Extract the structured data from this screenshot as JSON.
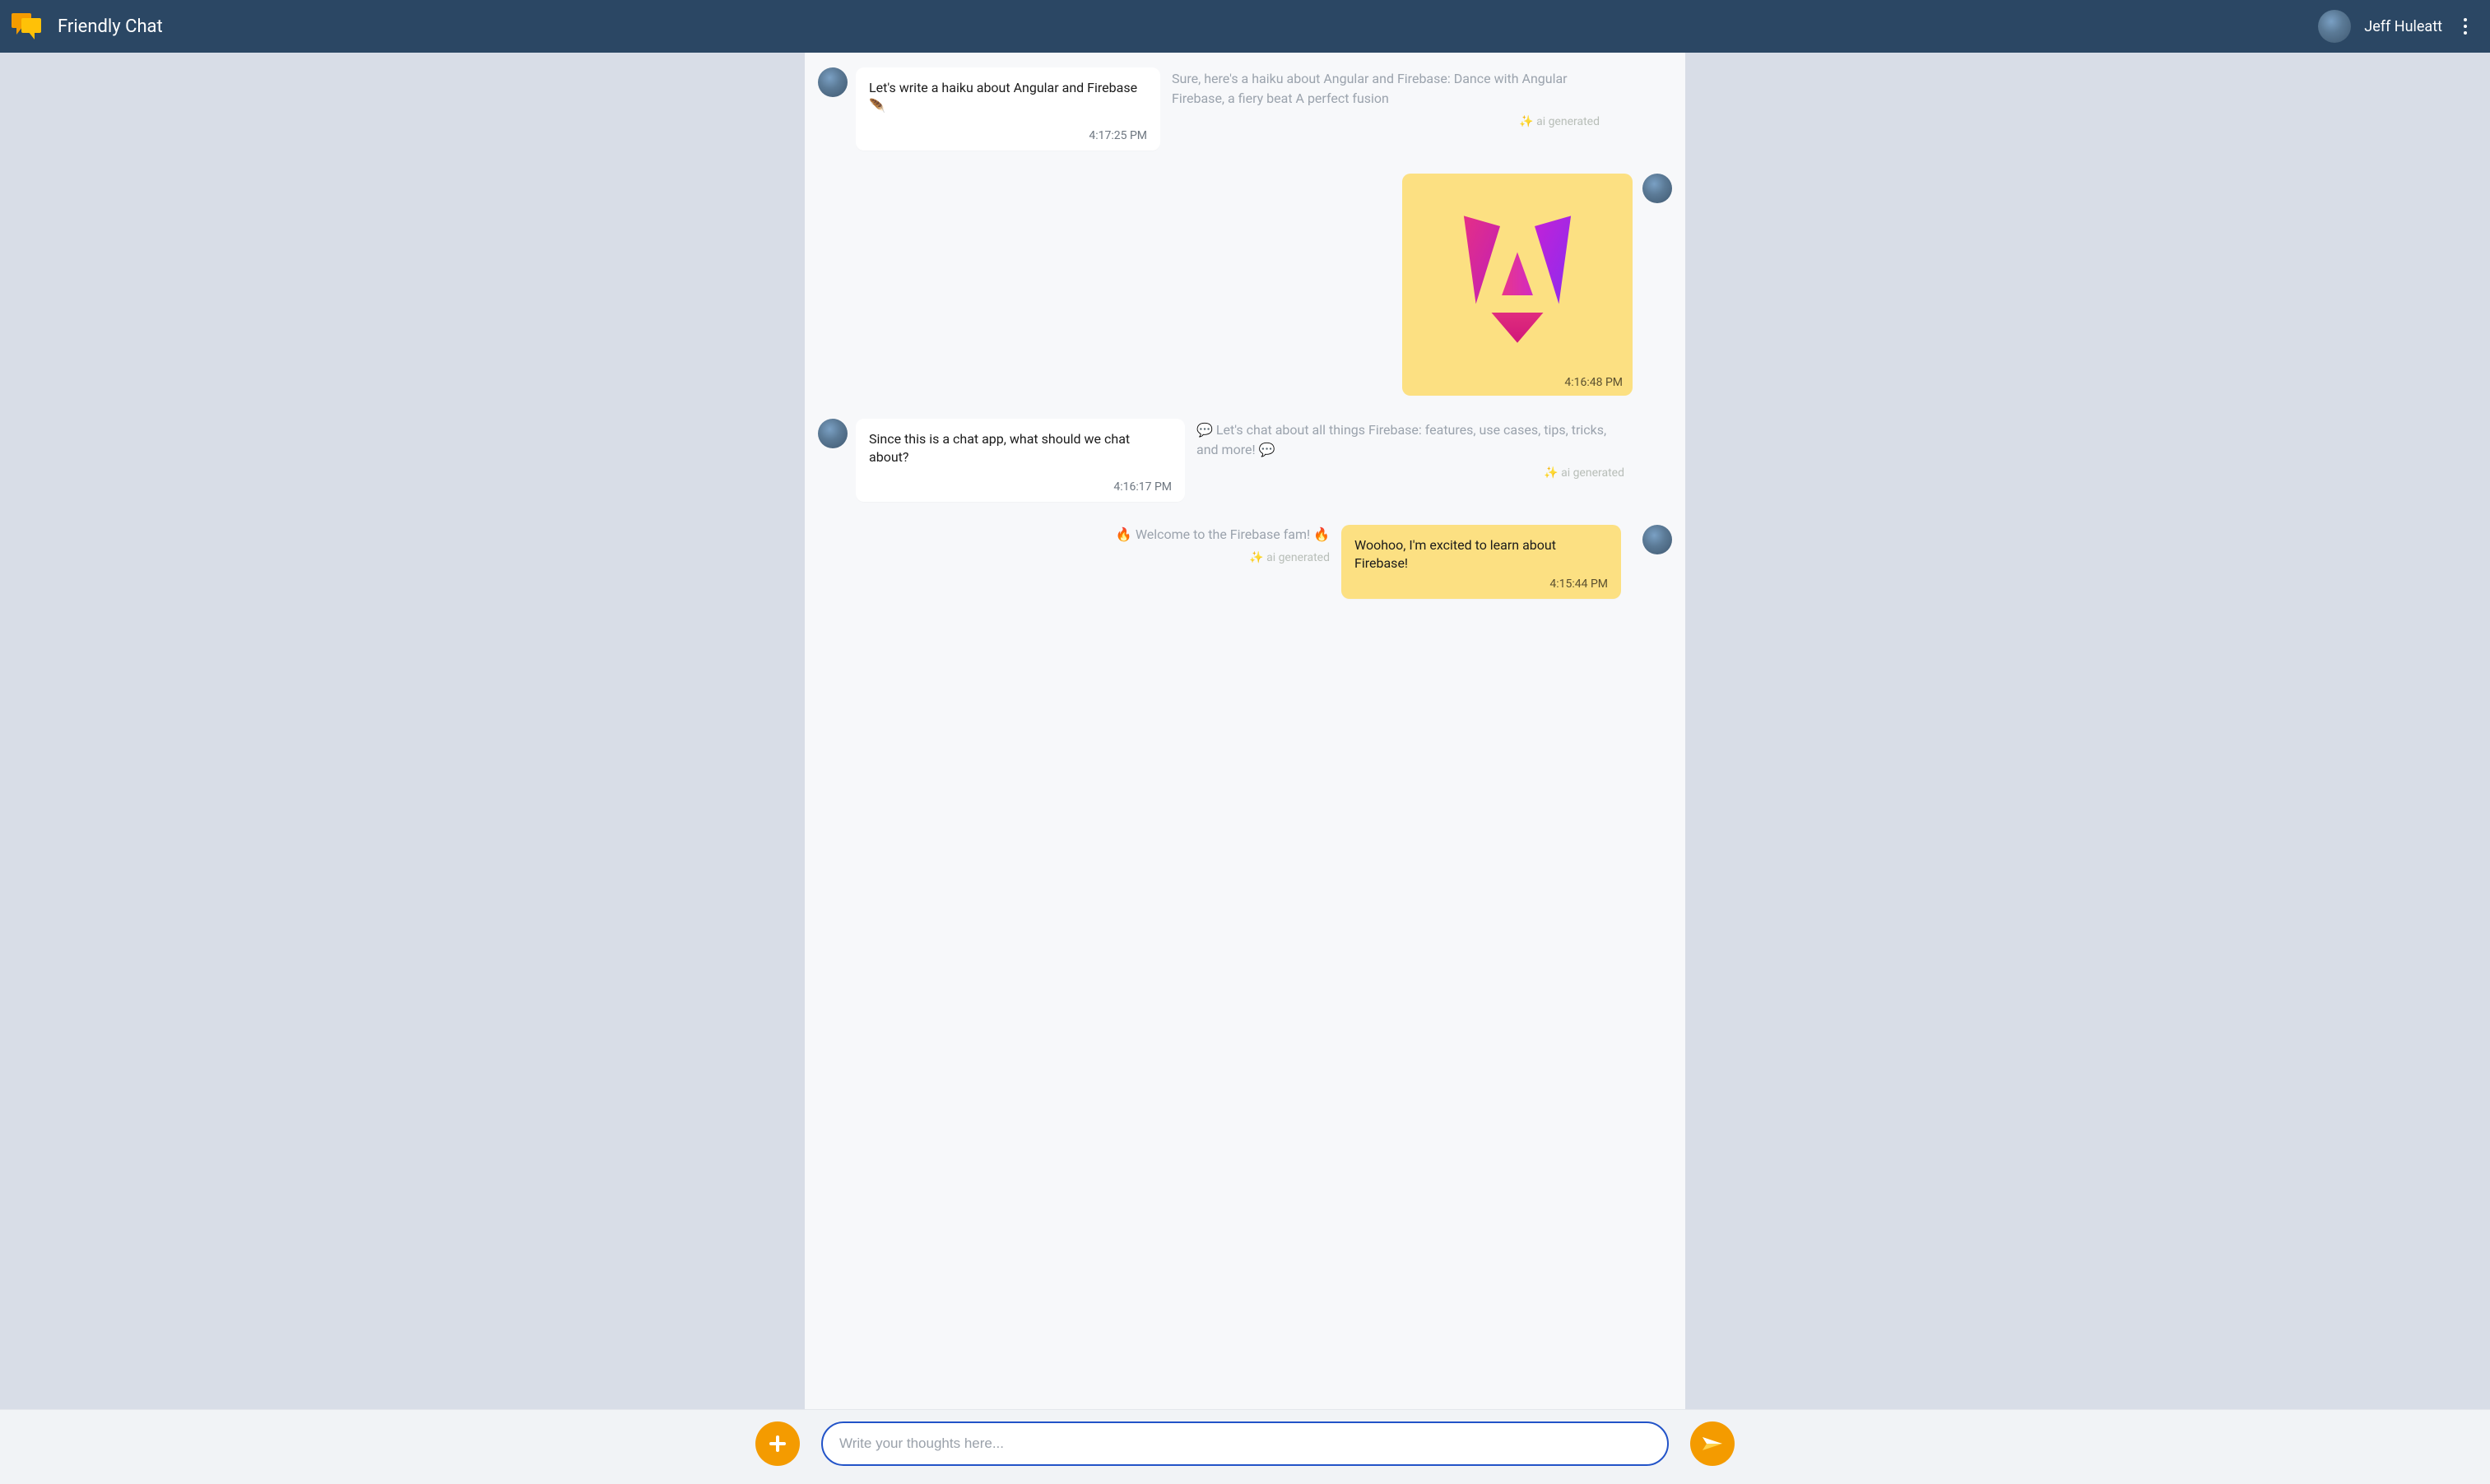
{
  "header": {
    "app_title": "Friendly Chat",
    "user_name": "Jeff Huleatt"
  },
  "composer": {
    "placeholder": "Write your thoughts here..."
  },
  "ai_tag": "✨ ai generated",
  "messages": {
    "m1": {
      "text": "Let's write a haiku about Angular and Firebase 🪶",
      "time": "4:17:25 PM",
      "ai_reply": "Sure, here's a haiku about Angular and Firebase: Dance with Angular Firebase, a fiery beat A perfect fusion"
    },
    "m2_image": {
      "time": "4:16:48 PM"
    },
    "m3": {
      "text": "Since this is a chat app, what should we chat about?",
      "time": "4:16:17 PM",
      "ai_reply": "💬 Let's chat about all things Firebase: features, use cases, tips, tricks, and more! 💬"
    },
    "m4": {
      "text": "Woohoo, I'm excited to learn about Firebase!",
      "time": "4:15:44 PM",
      "ai_reply": "🔥 Welcome to the Firebase fam! 🔥"
    }
  }
}
